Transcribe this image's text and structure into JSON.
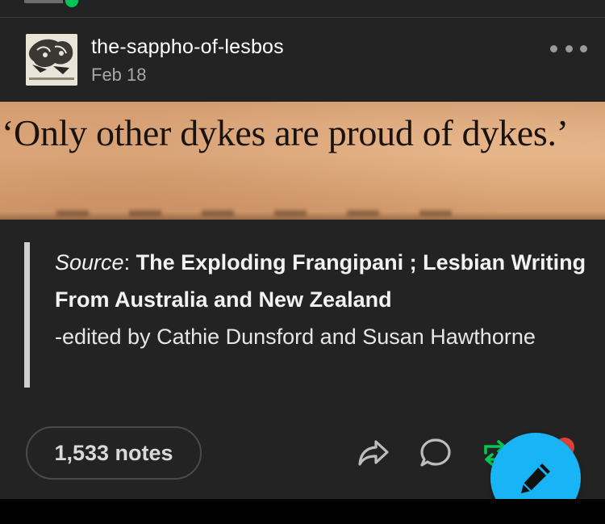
{
  "post": {
    "username": "the-sappho-of-lesbos",
    "date": "Feb 18",
    "image_quote": "‘Only other dykes are proud of dykes.’",
    "source": {
      "label": "Source",
      "separator": ": ",
      "title": "The Exploding Frangipani ; Lesbian Writing From Australia and New Zealand",
      "editors": "-edited by Cathie Dunsford and Susan Hawthorne"
    },
    "notes": "1,533 notes"
  },
  "icons": {
    "more": "more-options-icon",
    "share": "share-icon",
    "reply": "reply-icon",
    "reblog": "reblog-icon",
    "compose": "pencil-icon"
  },
  "colors": {
    "background": "#232323",
    "compose_fab": "#19b4f5",
    "reblog": "#00c853",
    "like": "#e0423a"
  }
}
